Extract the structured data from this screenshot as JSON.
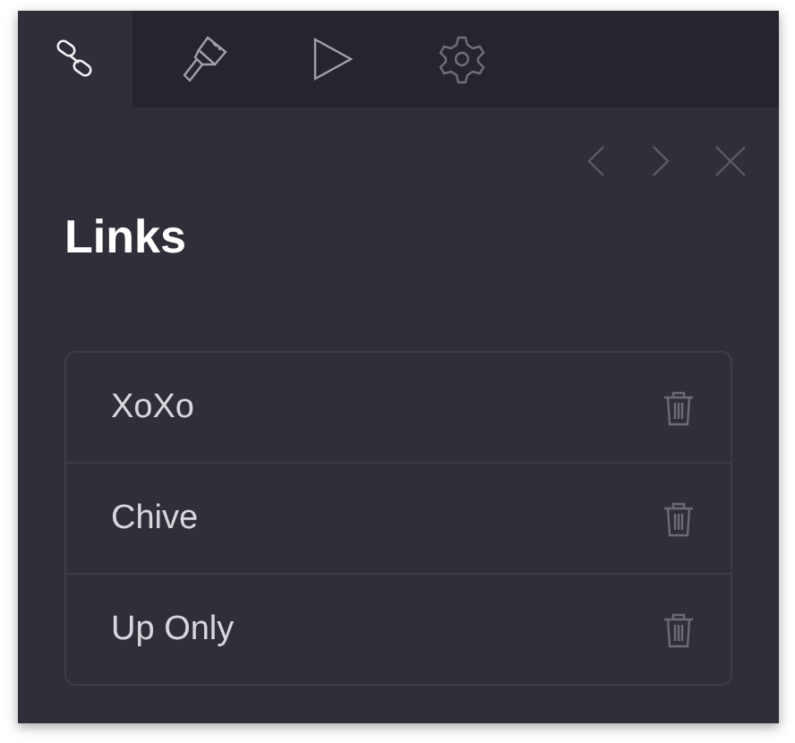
{
  "tabs": [
    {
      "kind": "link",
      "selected": true
    },
    {
      "kind": "brush",
      "selected": false
    },
    {
      "kind": "play",
      "selected": false
    },
    {
      "kind": "gear",
      "selected": false
    }
  ],
  "title": "Links",
  "links": [
    {
      "name": "XoXo"
    },
    {
      "name": "Chive"
    },
    {
      "name": "Up Only"
    }
  ]
}
